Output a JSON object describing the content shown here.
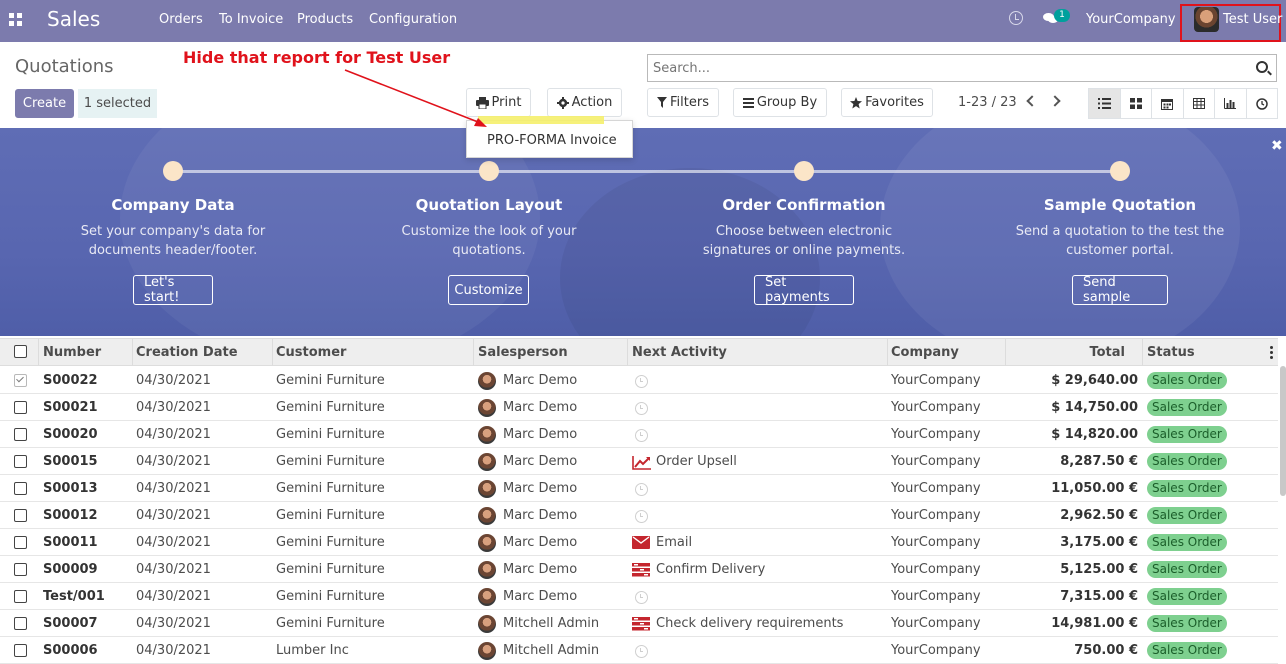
{
  "navbar": {
    "brand": "Sales",
    "menu": [
      "Orders",
      "To Invoice",
      "Products",
      "Configuration"
    ],
    "chat_count": "1",
    "company": "YourCompany",
    "user": "Test User",
    "bg_color": "#7c7bad"
  },
  "control": {
    "breadcrumb": "Quotations",
    "create_label": "Create",
    "selected_label": "1 selected",
    "print_label": "Print",
    "action_label": "Action",
    "search_placeholder": "Search...",
    "filters_label": "Filters",
    "groupby_label": "Group By",
    "favorites_label": "Favorites",
    "pager": "1-23 / 23",
    "views": [
      "list-icon",
      "kanban-icon",
      "calendar-icon",
      "pivot-icon",
      "graph-icon",
      "activity-icon"
    ]
  },
  "annotation": {
    "text": "Hide that report for Test User",
    "color": "#e0121b"
  },
  "print_dropdown": {
    "items": [
      "PRO-FORMA Invoice"
    ]
  },
  "onboarding": {
    "steps": [
      {
        "title": "Company Data",
        "desc_line1": "Set your company's data for",
        "desc_line2": "documents header/footer.",
        "button": "Let's start!"
      },
      {
        "title": "Quotation Layout",
        "desc_line1": "Customize the look of your",
        "desc_line2": "quotations.",
        "button": "Customize"
      },
      {
        "title": "Order Confirmation",
        "desc_line1": "Choose between electronic",
        "desc_line2": "signatures or online payments.",
        "button": "Set payments"
      },
      {
        "title": "Sample Quotation",
        "desc_line1": "Send a quotation to the test the",
        "desc_line2": "customer portal.",
        "button": "Send sample"
      }
    ]
  },
  "table": {
    "columns": [
      "Number",
      "Creation Date",
      "Customer",
      "Salesperson",
      "Next Activity",
      "Company",
      "Total",
      "Status"
    ],
    "rows": [
      {
        "checked": true,
        "number": "S00022",
        "date": "04/30/2021",
        "customer": "Gemini Furniture",
        "salesperson": "Marc Demo",
        "activity": "",
        "activity_icon": "clock-icon",
        "company": "YourCompany",
        "total": "$ 29,640.00",
        "status": "Sales Order"
      },
      {
        "checked": false,
        "number": "S00021",
        "date": "04/30/2021",
        "customer": "Gemini Furniture",
        "salesperson": "Marc Demo",
        "activity": "",
        "activity_icon": "clock-icon",
        "company": "YourCompany",
        "total": "$ 14,750.00",
        "status": "Sales Order"
      },
      {
        "checked": false,
        "number": "S00020",
        "date": "04/30/2021",
        "customer": "Gemini Furniture",
        "salesperson": "Marc Demo",
        "activity": "",
        "activity_icon": "clock-icon",
        "company": "YourCompany",
        "total": "$ 14,820.00",
        "status": "Sales Order"
      },
      {
        "checked": false,
        "number": "S00015",
        "date": "04/30/2021",
        "customer": "Gemini Furniture",
        "salesperson": "Marc Demo",
        "activity": "Order Upsell",
        "activity_icon": "line-chart-icon",
        "company": "YourCompany",
        "total": "8,287.50 €",
        "status": "Sales Order"
      },
      {
        "checked": false,
        "number": "S00013",
        "date": "04/30/2021",
        "customer": "Gemini Furniture",
        "salesperson": "Marc Demo",
        "activity": "",
        "activity_icon": "clock-icon",
        "company": "YourCompany",
        "total": "11,050.00 €",
        "status": "Sales Order"
      },
      {
        "checked": false,
        "number": "S00012",
        "date": "04/30/2021",
        "customer": "Gemini Furniture",
        "salesperson": "Marc Demo",
        "activity": "",
        "activity_icon": "clock-icon",
        "company": "YourCompany",
        "total": "2,962.50 €",
        "status": "Sales Order"
      },
      {
        "checked": false,
        "number": "S00011",
        "date": "04/30/2021",
        "customer": "Gemini Furniture",
        "salesperson": "Marc Demo",
        "activity": "Email",
        "activity_icon": "envelope-icon",
        "company": "YourCompany",
        "total": "3,175.00 €",
        "status": "Sales Order"
      },
      {
        "checked": false,
        "number": "S00009",
        "date": "04/30/2021",
        "customer": "Gemini Furniture",
        "salesperson": "Marc Demo",
        "activity": "Confirm Delivery",
        "activity_icon": "tasks-icon",
        "company": "YourCompany",
        "total": "5,125.00 €",
        "status": "Sales Order"
      },
      {
        "checked": false,
        "number": "Test/001",
        "date": "04/30/2021",
        "customer": "Gemini Furniture",
        "salesperson": "Marc Demo",
        "activity": "",
        "activity_icon": "clock-icon",
        "company": "YourCompany",
        "total": "7,315.00 €",
        "status": "Sales Order"
      },
      {
        "checked": false,
        "number": "S00007",
        "date": "04/30/2021",
        "customer": "Gemini Furniture",
        "salesperson": "Mitchell Admin",
        "activity": "Check delivery requirements",
        "activity_icon": "tasks-icon",
        "company": "YourCompany",
        "total": "14,981.00 €",
        "status": "Sales Order"
      },
      {
        "checked": false,
        "number": "S00006",
        "date": "04/30/2021",
        "customer": "Lumber Inc",
        "salesperson": "Mitchell Admin",
        "activity": "",
        "activity_icon": "clock-icon",
        "company": "YourCompany",
        "total": "750.00 €",
        "status": "Sales Order"
      }
    ]
  }
}
